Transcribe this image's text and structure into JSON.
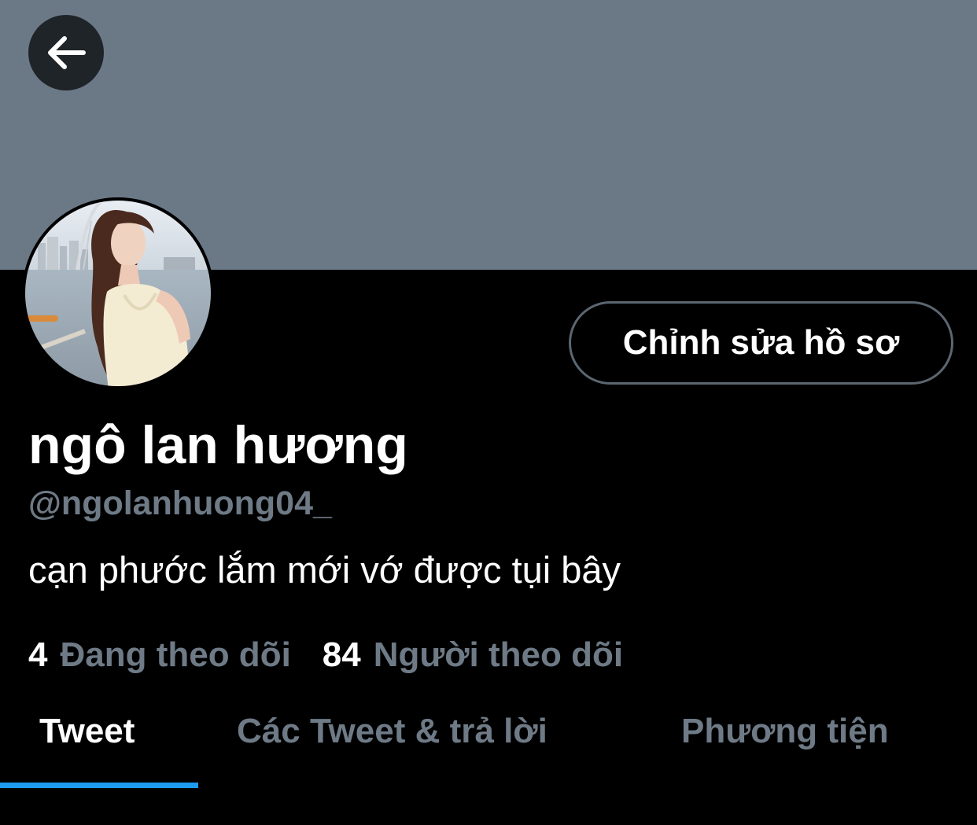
{
  "header": {
    "back_icon": "arrow-left-icon",
    "banner_color": "#6b7987"
  },
  "profile": {
    "edit_label": "Chỉnh sửa hồ sơ",
    "display_name": "ngô lan hương",
    "handle": "@ngolanhuong04_",
    "bio": "cạn phước lắm mới vớ được tụi bây",
    "following": {
      "count": "4",
      "label": "Đang theo dõi"
    },
    "followers": {
      "count": "84",
      "label": "Người theo dõi"
    }
  },
  "tabs": [
    {
      "label": "Tweet",
      "active": true
    },
    {
      "label": "Các Tweet & trả lời",
      "active": false
    },
    {
      "label": "Phương tiện",
      "active": false
    }
  ],
  "colors": {
    "accent": "#1d9bf0",
    "muted_text": "#6e7a86",
    "background": "#000000"
  }
}
